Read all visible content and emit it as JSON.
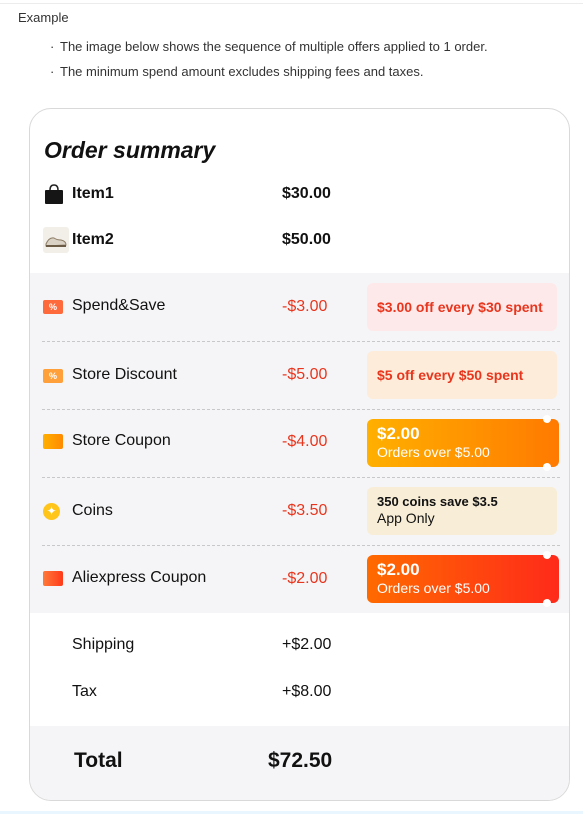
{
  "header": {
    "title": "Example",
    "bullets": [
      "The image below shows the sequence of multiple offers applied to 1 order.",
      "The minimum spend amount excludes shipping fees and taxes."
    ]
  },
  "summary": {
    "title": "Order summary",
    "items": [
      {
        "label": "Item1",
        "amount": "$30.00",
        "icon": "handbag-icon"
      },
      {
        "label": "Item2",
        "amount": "$50.00",
        "icon": "sneaker-icon"
      }
    ],
    "discounts": [
      {
        "label": "Spend&Save",
        "amount": "-$3.00",
        "icon": "percent-tag-icon",
        "note": "$3.00 off every $30 spent"
      },
      {
        "label": "Store Discount",
        "amount": "-$5.00",
        "icon": "percent-tag-icon",
        "note": "$5 off every $50 spent"
      },
      {
        "label": "Store Coupon",
        "amount": "-$4.00",
        "icon": "coupon-icon",
        "coupon_value": "$2.00",
        "coupon_condition": "Orders over $5.00"
      },
      {
        "label": "Coins",
        "amount": "-$3.50",
        "icon": "coin-icon",
        "note_line1": "350 coins save $3.5",
        "note_line2": "App Only"
      },
      {
        "label": "Aliexpress Coupon",
        "amount": "-$2.00",
        "icon": "coupon-icon",
        "coupon_value": "$2.00",
        "coupon_condition": "Orders over $5.00"
      }
    ],
    "fees": [
      {
        "label": "Shipping",
        "amount": "+$2.00"
      },
      {
        "label": "Tax",
        "amount": "+$8.00"
      }
    ],
    "total": {
      "label": "Total",
      "amount": "$72.50"
    }
  },
  "colors": {
    "discount_red": "#e8361e",
    "band_gray": "#f5f5f7",
    "coupon_orange": "#ff8a00",
    "coupon_red": "#ff2a1a",
    "coin_yellow": "#ffc51a"
  }
}
